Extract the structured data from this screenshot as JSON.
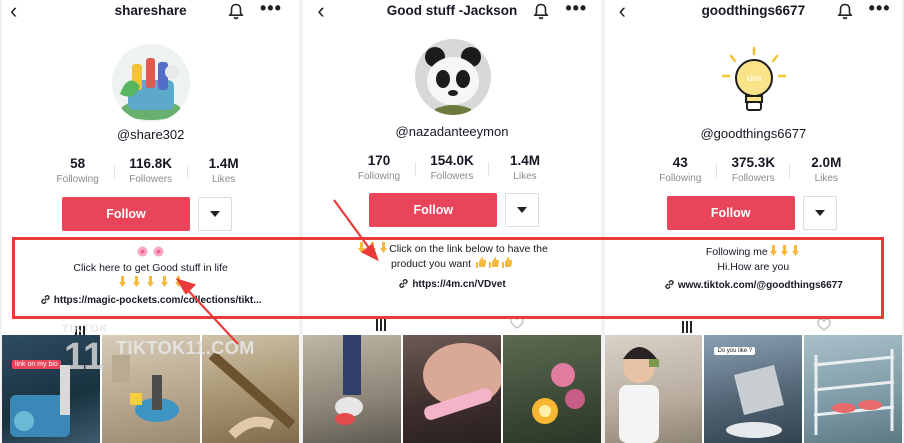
{
  "colors": {
    "follow_bg": "#e8445a",
    "highlight": "#ea3b3b",
    "muted": "#8a8b91"
  },
  "profiles": [
    {
      "title": "shareshare",
      "handle": "@share302",
      "stats": [
        {
          "value": "58",
          "label": "Following"
        },
        {
          "value": "116.8K",
          "label": "Followers"
        },
        {
          "value": "1.4M",
          "label": "Likes"
        }
      ],
      "follow_label": "Follow",
      "bio_lines": [
        "Click here to get Good stuff in life"
      ],
      "link": "https://magic-pockets.com/collections/tikt...",
      "thumb_badge": "link on my bio"
    },
    {
      "title": "Good stuff -Jackson",
      "handle": "@nazadanteeymon",
      "stats": [
        {
          "value": "170",
          "label": "Following"
        },
        {
          "value": "154.0K",
          "label": "Followers"
        },
        {
          "value": "1.4M",
          "label": "Likes"
        }
      ],
      "follow_label": "Follow",
      "bio_lines": [
        "Click on the link below to have the",
        "product you want"
      ],
      "link": "https://4m.cn/VDvet"
    },
    {
      "title": "goodthings6677",
      "handle": "@goodthings6677",
      "stats": [
        {
          "value": "43",
          "label": "Following"
        },
        {
          "value": "375.3K",
          "label": "Followers"
        },
        {
          "value": "2.0M",
          "label": "Likes"
        }
      ],
      "follow_label": "Follow",
      "bio_lines": [
        "Following me",
        "Hi.How are you"
      ],
      "link": "www.tiktok.com/@goodthings6677",
      "avatar_text": "idea",
      "thumb_text": "Do you like ?"
    }
  ],
  "watermark": {
    "brand_small": "TIKTOK",
    "brand_big": "TIKTOK11.COM",
    "brand_num": "11"
  },
  "icons": [
    "chevron-left-icon",
    "bell-icon",
    "more-icon",
    "link-icon",
    "grid-icon",
    "heart-icon"
  ]
}
